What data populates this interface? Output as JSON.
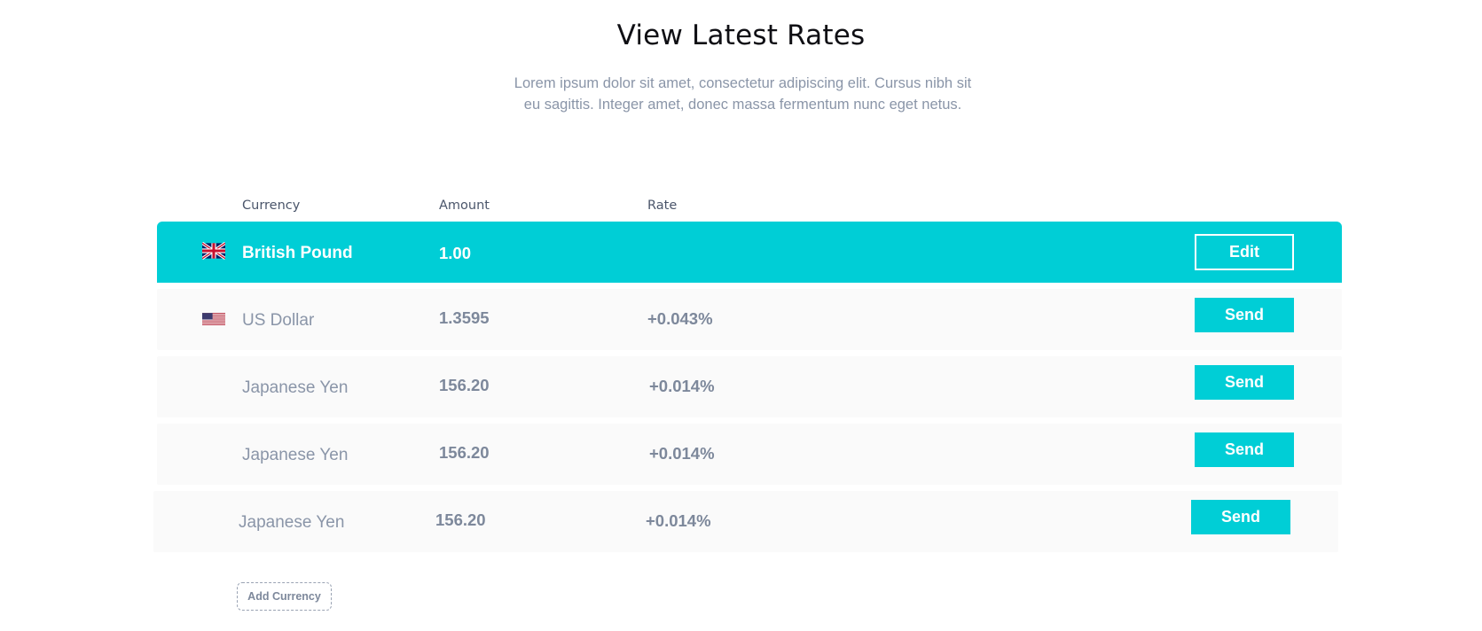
{
  "header": {
    "title": "View Latest Rates",
    "subtitle_line1": "Lorem ipsum dolor sit amet, consectetur adipiscing elit. Cursus nibh sit",
    "subtitle_line2": "eu sagittis. Integer amet, donec massa fermentum nunc eget netus."
  },
  "table": {
    "columns": [
      "Currency",
      "Amount",
      "Rate"
    ],
    "rows": [
      {
        "flag": "uk-flag-icon",
        "currency": "British Pound",
        "amount": "1.00",
        "rate": "",
        "action": "Edit"
      },
      {
        "flag": "us-flag-icon",
        "currency": "US Dollar",
        "amount": "1.3595",
        "rate": "+0.043%",
        "action": "Send"
      },
      {
        "flag": "",
        "currency": "Japanese Yen",
        "amount": "156.20",
        "rate": "+0.014%",
        "action": "Send"
      },
      {
        "flag": "",
        "currency": "Japanese Yen",
        "amount": "156.20",
        "rate": "+0.014%",
        "action": "Send"
      },
      {
        "flag": "",
        "currency": "Japanese Yen",
        "amount": "156.20",
        "rate": "+0.014%",
        "action": "Send"
      }
    ]
  },
  "add_currency_label": "Add Currency",
  "colors": {
    "accent": "#00ced6",
    "row_bg": "#fafafa",
    "muted_text": "#8a95a8"
  }
}
